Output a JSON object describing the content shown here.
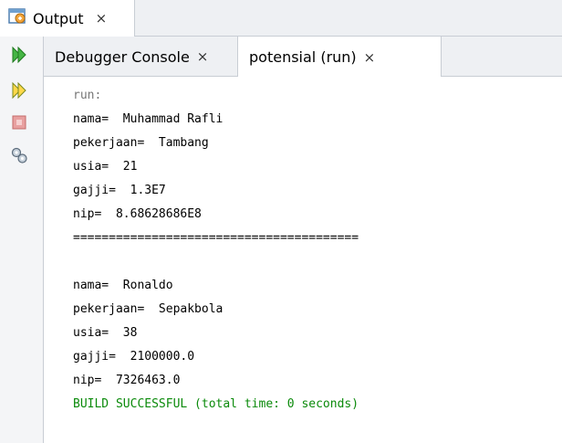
{
  "window_tab": {
    "label": "Output",
    "close": "×"
  },
  "console_tabs": [
    {
      "label": "Debugger Console",
      "close": "×"
    },
    {
      "label": "potensial (run)",
      "close": "×"
    }
  ],
  "toolbar": {
    "icons": [
      "rerun-icon",
      "rerun-with-options-icon",
      "stop-icon",
      "settings-icon"
    ]
  },
  "console": {
    "lines": [
      "run:",
      "nama=  Muhammad Rafli",
      "pekerjaan=  Tambang",
      "usia=  21",
      "gajji=  1.3E7",
      "nip=  8.68628686E8",
      "========================================",
      "",
      "nama=  Ronaldo",
      "pekerjaan=  Sepakbola",
      "usia=  38",
      "gajji=  2100000.0",
      "nip=  7326463.0",
      "BUILD SUCCESSFUL (total time: 0 seconds)"
    ]
  },
  "colors": {
    "success": "#0a8a0a",
    "muted": "#777777",
    "accent": "#2d9b2d"
  }
}
